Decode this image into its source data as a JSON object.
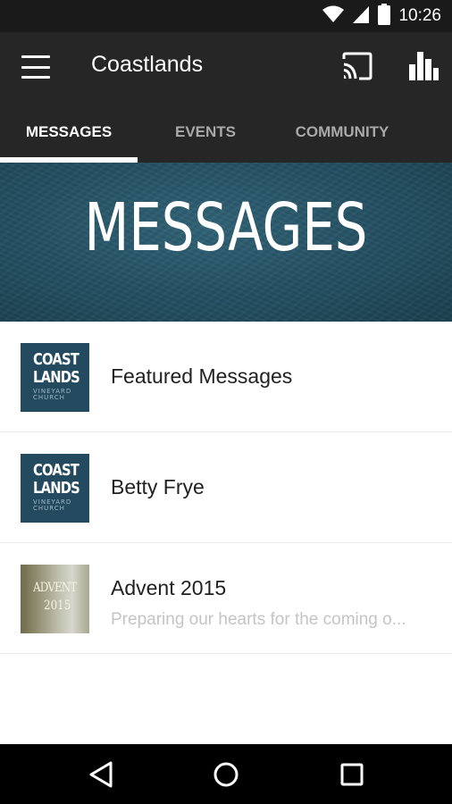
{
  "status_bar": {
    "time": "10:26",
    "icons": [
      "wifi-icon",
      "cell-signal-icon",
      "battery-icon"
    ]
  },
  "app_bar": {
    "title": "Coastlands",
    "icons": [
      "menu-icon",
      "cast-icon",
      "bar-chart-icon"
    ]
  },
  "tabs": [
    {
      "label": "MESSAGES",
      "selected": true
    },
    {
      "label": "EVENTS",
      "selected": false
    },
    {
      "label": "COMMUNITY",
      "selected": false
    }
  ],
  "hero": {
    "title": "MESSAGES"
  },
  "list": [
    {
      "title": "Featured Messages",
      "subtitle": "",
      "thumb": {
        "line1": "COAST",
        "line2": "LANDS",
        "line3": "VINEYARD CHURCH"
      }
    },
    {
      "title": "Betty Frye",
      "subtitle": "",
      "thumb": {
        "line1": "COAST",
        "line2": "LANDS",
        "line3": "VINEYARD CHURCH"
      }
    },
    {
      "title": "Advent 2015",
      "subtitle": "Preparing our hearts for the coming o...",
      "thumb": {
        "line1": "ADVENT",
        "line2": "2015"
      }
    }
  ],
  "nav_bar": {
    "icons": [
      "back-icon",
      "home-icon",
      "recents-icon"
    ]
  },
  "colors": {
    "status_bar": "#1a1a1a",
    "app_bar": "#262626",
    "tab_active": "#ffffff",
    "tab_inactive": "#a9a9a9",
    "hero_bg": "#234f61",
    "logo_bg": "#234a5f"
  }
}
